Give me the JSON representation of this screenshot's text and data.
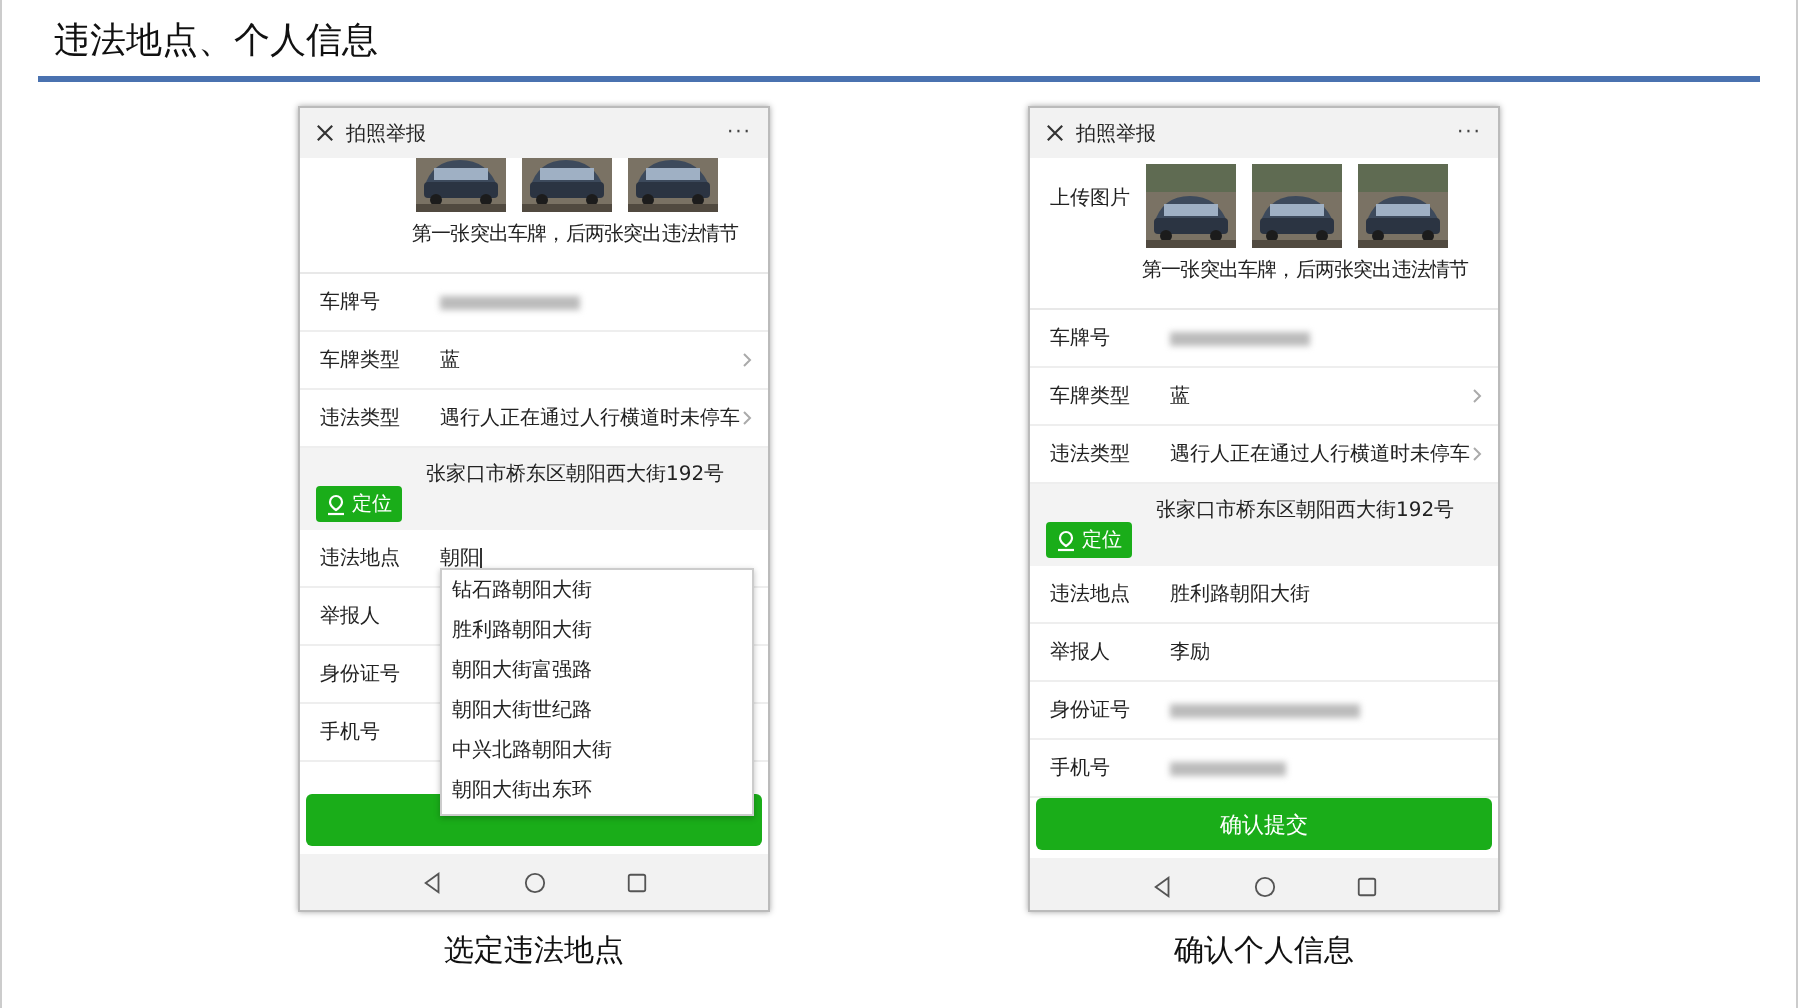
{
  "slide_title": "违法地点、个人信息",
  "phones": [
    {
      "header": {
        "title": "拍照举报",
        "menu": "···"
      },
      "scrolled": true,
      "photos": {
        "caption": "第一张突出车牌，后两张突出违法情节"
      },
      "fields_top": [
        {
          "label": "车牌号",
          "kind": "blurred"
        },
        {
          "label": "车牌类型",
          "kind": "select",
          "value": "蓝"
        },
        {
          "label": "违法类型",
          "kind": "select",
          "value": "遇行人正在通过人行横道时未停车"
        }
      ],
      "location": {
        "button": "定位",
        "address": "张家口市桥东区朝阳西大街192号"
      },
      "fields_bottom": [
        {
          "label": "违法地点",
          "kind": "input",
          "value": "朝阳",
          "suggestions": [
            "钻石路朝阳大街",
            "胜利路朝阳大街",
            "朝阳大街富强路",
            "朝阳大街世纪路",
            "中兴北路朝阳大街",
            "朝阳大街出东环"
          ]
        },
        {
          "label": "举报人",
          "kind": "empty"
        },
        {
          "label": "身份证号",
          "kind": "empty"
        },
        {
          "label": "手机号",
          "kind": "empty"
        }
      ],
      "submit": {
        "shown": true
      },
      "caption": "选定违法地点"
    },
    {
      "header": {
        "title": "拍照举报",
        "menu": "···"
      },
      "scrolled": false,
      "photos": {
        "label": "上传图片",
        "caption": "第一张突出车牌，后两张突出违法情节"
      },
      "fields_top": [
        {
          "label": "车牌号",
          "kind": "blurred"
        },
        {
          "label": "车牌类型",
          "kind": "select",
          "value": "蓝"
        },
        {
          "label": "违法类型",
          "kind": "select",
          "value": "遇行人正在通过人行横道时未停车"
        }
      ],
      "location": {
        "button": "定位",
        "address": "张家口市桥东区朝阳西大街192号"
      },
      "fields_bottom": [
        {
          "label": "违法地点",
          "kind": "text",
          "value": "胜利路朝阳大街"
        },
        {
          "label": "举报人",
          "kind": "text",
          "value": "李励"
        },
        {
          "label": "身份证号",
          "kind": "blurred"
        },
        {
          "label": "手机号",
          "kind": "blurred"
        }
      ],
      "submit": {
        "shown": true,
        "label": "确认提交"
      },
      "caption": "确认个人信息"
    }
  ]
}
